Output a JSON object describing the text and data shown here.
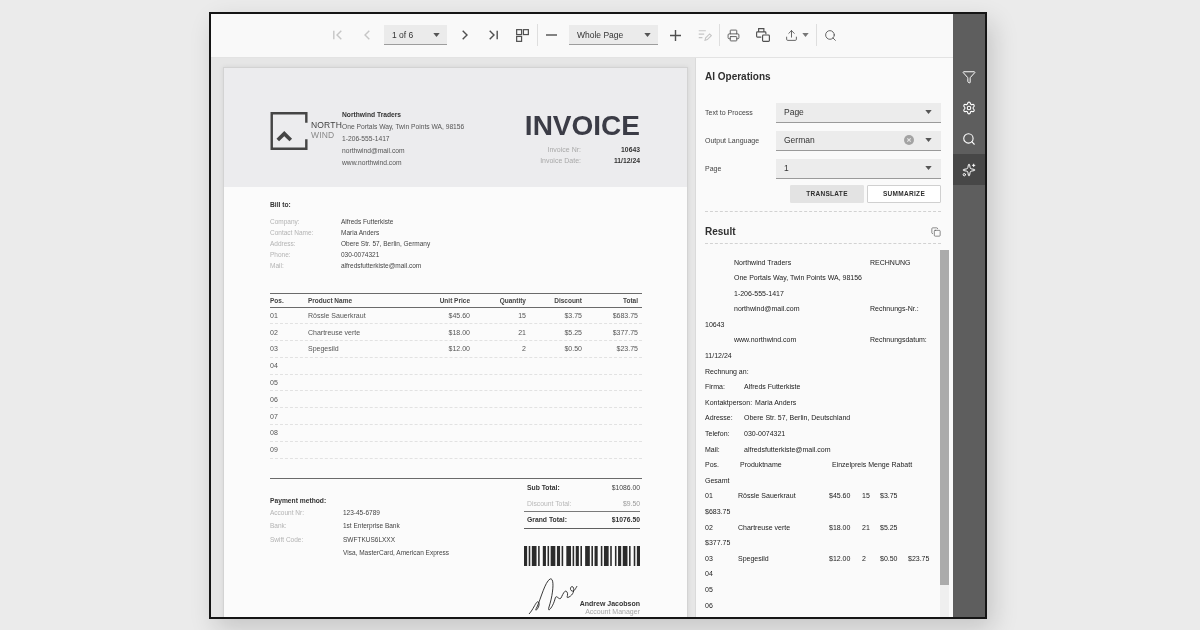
{
  "toolbar": {
    "first_page": {
      "disabled": true
    },
    "previous_page": {
      "disabled": true
    },
    "page_selector": {
      "value": "1 of 6"
    },
    "next_page": {
      "disabled": false
    },
    "last_page": {
      "disabled": false
    },
    "zoom_selector": {
      "value": "Whole Page"
    },
    "edit": {
      "disabled": true
    }
  },
  "invoice": {
    "logo": [
      "NORTH",
      "WIND"
    ],
    "company": {
      "name": "Northwind Traders",
      "lines": [
        "One Portals Way, Twin Points WA, 98156",
        "1-206-555-1417",
        "northwind@mail.com",
        "www.northwind.com"
      ]
    },
    "title": "INVOICE",
    "meta": [
      {
        "label": "Invoice Nr:",
        "value": "10643"
      },
      {
        "label": "Invoice Date:",
        "value": "11/12/24"
      }
    ],
    "bill_to": {
      "title": "Bill to:",
      "rows": [
        {
          "label": "Company:",
          "value": "Alfreds Futterkiste"
        },
        {
          "label": "Contact Name:",
          "value": "Maria Anders"
        },
        {
          "label": "Address:",
          "value": "Obere Str. 57, Berlin, Germany"
        },
        {
          "label": "Phone:",
          "value": "030-0074321"
        },
        {
          "label": "Mail:",
          "value": "alfredsfutterkiste@mail.com"
        }
      ]
    },
    "items": {
      "columns": [
        "Pos.",
        "Product Name",
        "Unit Price",
        "Quantity",
        "Discount",
        "Total"
      ],
      "rows": [
        [
          "01",
          "Rössle Sauerkraut",
          "$45.60",
          "15",
          "$3.75",
          "$683.75"
        ],
        [
          "02",
          "Chartreuse verte",
          "$18.00",
          "21",
          "$5.25",
          "$377.75"
        ],
        [
          "03",
          "Spegesild",
          "$12.00",
          "2",
          "$0.50",
          "$23.75"
        ],
        [
          "04"
        ],
        [
          "05"
        ],
        [
          "06"
        ],
        [
          "07"
        ],
        [
          "08"
        ],
        [
          "09"
        ]
      ]
    },
    "totals": [
      {
        "kind": "sub",
        "label": "Sub Total:",
        "value": "$1086.00"
      },
      {
        "kind": "discount",
        "label": "Discount Total:",
        "value": "$9.50"
      },
      {
        "kind": "grand",
        "label": "Grand Total:",
        "value": "$1076.50"
      }
    ],
    "payment": {
      "title": "Payment method:",
      "rows": [
        {
          "label": "Account Nr:",
          "value": "123-45-6789"
        },
        {
          "label": "Bank:",
          "value": "1st Enterprise Bank"
        },
        {
          "label": "Swift Code:",
          "value": "SWFTKUS6LXXX"
        },
        {
          "value": "Visa, MasterCard, American Express"
        }
      ]
    },
    "signer": {
      "name": "Andrew Jacobson",
      "role": "Account Manager"
    }
  },
  "ai_panel": {
    "title": "AI Operations",
    "fields": [
      {
        "label": "Text to Process",
        "value": "Page",
        "clear_button": false
      },
      {
        "label": "Output Language",
        "value": "German",
        "clear_button": true
      },
      {
        "label": "Page",
        "value": "1",
        "clear_button": false
      }
    ],
    "buttons": [
      {
        "label": "TRANSLATE",
        "kind": "filled"
      },
      {
        "label": "SUMMARIZE",
        "kind": "outlined"
      }
    ],
    "result": {
      "title": "Result",
      "lines": [
        {
          "kind": "company",
          "cells": [
            "Northwind Traders",
            "RECHNUNG"
          ]
        },
        {
          "kind": "company",
          "cells": [
            "One Portals Way, Twin Points WA, 98156"
          ]
        },
        {
          "kind": "company",
          "cells": [
            "1-206-555-1417"
          ]
        },
        {
          "kind": "company",
          "cells": [
            "northwind@mail.com",
            "Rechnungs-Nr.:"
          ]
        },
        {
          "kind": "plain",
          "cells": [
            "10643"
          ]
        },
        {
          "kind": "company",
          "cells": [
            "www.northwind.com",
            "Rechnungsdatum:"
          ]
        },
        {
          "kind": "plain",
          "cells": [
            "11/12/24"
          ]
        },
        {
          "kind": "plain",
          "cells": [
            "Rechnung an:"
          ]
        },
        {
          "kind": "field",
          "cells": [
            "Firma:",
            "Alfreds Futterkiste"
          ]
        },
        {
          "kind": "field",
          "cells": [
            "Kontaktperson:",
            "Maria Anders"
          ]
        },
        {
          "kind": "field",
          "cells": [
            "Adresse:",
            "Obere Str. 57, Berlin, Deutschland"
          ]
        },
        {
          "kind": "field",
          "cells": [
            "Telefon:",
            "030-0074321"
          ]
        },
        {
          "kind": "field",
          "cells": [
            "Mail:",
            "alfredsfutterkiste@mail.com"
          ]
        },
        {
          "kind": "header",
          "cells": [
            "Pos.",
            "Produktname",
            "Einzelpreis Menge Rabatt"
          ]
        },
        {
          "kind": "plain",
          "cells": [
            "Gesamt"
          ]
        },
        {
          "kind": "item",
          "cells": [
            "01",
            "Rössle Sauerkraut",
            "$45.60",
            "15",
            "$3.75"
          ]
        },
        {
          "kind": "plain",
          "cells": [
            "$683.75"
          ]
        },
        {
          "kind": "item",
          "cells": [
            "02",
            "Chartreuse verte",
            "$18.00",
            "21",
            "$5.25"
          ]
        },
        {
          "kind": "plain",
          "cells": [
            "$377.75"
          ]
        },
        {
          "kind": "item",
          "cells": [
            "03",
            "Spegesild",
            "$12.00",
            "2",
            "$0.50",
            "$23.75"
          ]
        },
        {
          "kind": "plain",
          "cells": [
            "04"
          ]
        },
        {
          "kind": "plain",
          "cells": [
            "05"
          ]
        },
        {
          "kind": "plain",
          "cells": [
            "06"
          ]
        }
      ]
    }
  },
  "sidebar": {
    "items": [
      {
        "selected": false
      },
      {
        "selected": false
      },
      {
        "selected": false
      },
      {
        "selected": true
      }
    ]
  }
}
